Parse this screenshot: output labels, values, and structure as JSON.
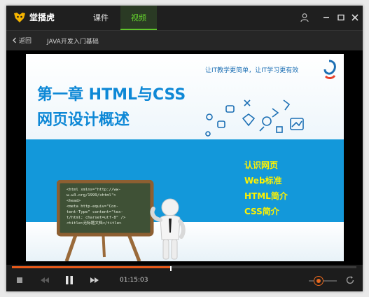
{
  "app": {
    "name": "堂播虎"
  },
  "tabs": [
    {
      "label": "课件"
    },
    {
      "label": "视频"
    }
  ],
  "titlebar_icons": [
    "user-icon",
    "minimize-icon",
    "maximize-icon",
    "close-icon"
  ],
  "nav": {
    "back_label": "返回",
    "breadcrumb": "JAVA开发入门基础"
  },
  "slide": {
    "slogan": "让IT教学更简单，让IT学习更有效",
    "title_line1": "第一章 HTML与CSS",
    "title_line2": "网页设计概述",
    "topics": [
      "认识网页",
      "Web标准",
      "HTML简介",
      "CSS简介"
    ],
    "blackboard_code": [
      "<html xmlns=\"http://ww-",
      "w.w3.org/1999/xhtml\">",
      "<head>",
      "<meta http-equiv=\"Con-",
      "tent-Type\" content=\"tex-",
      "t/html; charset=utf-8\" />",
      "<title>无标题文档</title>"
    ]
  },
  "player": {
    "current_time": "01:15:03",
    "progress_fraction": 0.46,
    "volume_fraction": 0.35,
    "colors": {
      "progress": "#e85a1a",
      "accent_green": "#5fc52a"
    }
  }
}
